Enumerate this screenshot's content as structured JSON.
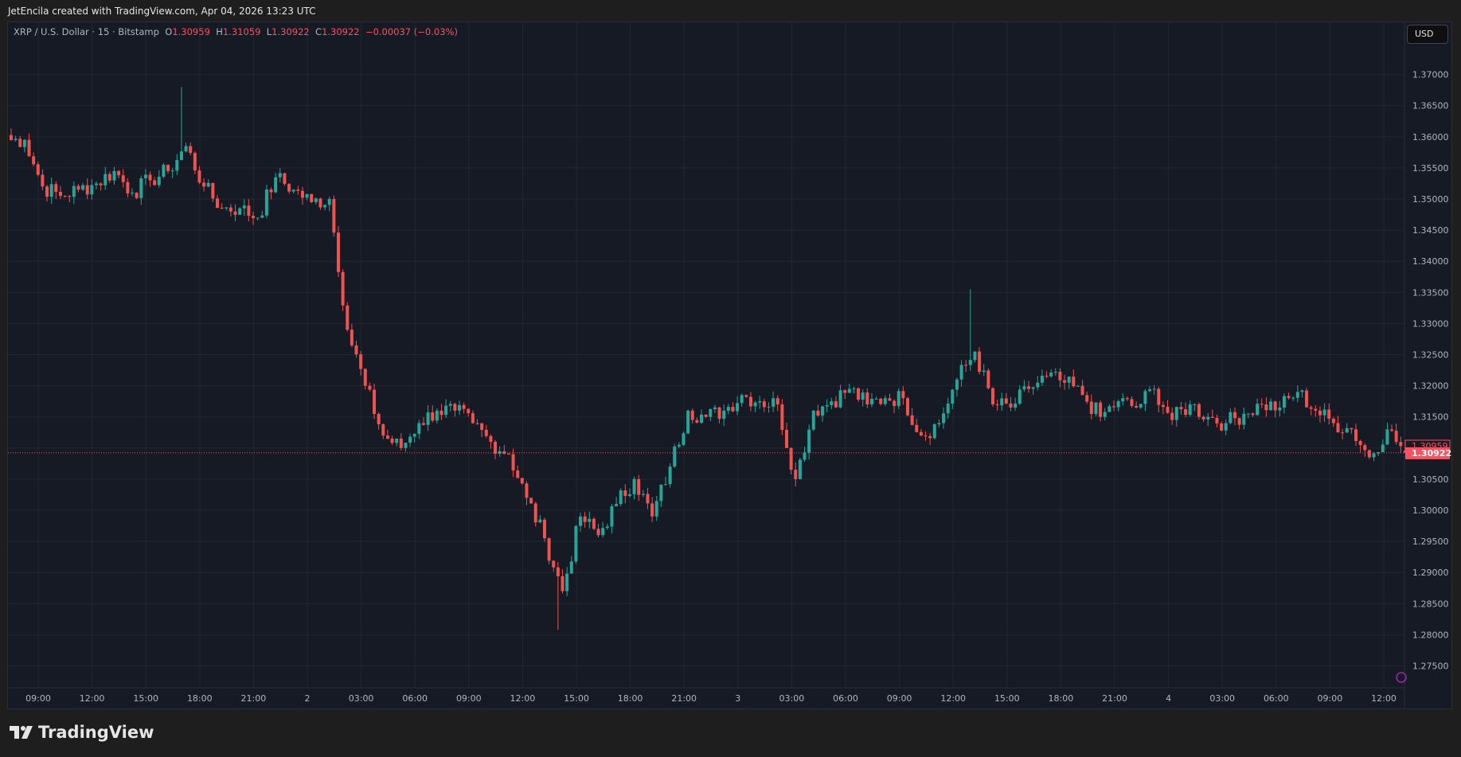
{
  "header": {
    "attribution": "JetEncila created with TradingView.com, Apr 04, 2026 13:23 UTC"
  },
  "legend": {
    "symbol": "XRP / U.S. Dollar · 15 · Bitstamp",
    "o_label": "O",
    "o": "1.30959",
    "h_label": "H",
    "h": "1.31059",
    "l_label": "L",
    "l": "1.30922",
    "c_label": "C",
    "c": "1.30922",
    "change": "−0.00037 (−0.03%)"
  },
  "currency_button": "USD",
  "logo_text": "TradingView",
  "colors": {
    "up": "#26a69a",
    "down": "#ef5350",
    "background": "#161a25",
    "grid": "#232733",
    "price_line": "#f7525f"
  },
  "chart_data": {
    "type": "candlestick",
    "interval": "15",
    "title": "XRP / U.S. Dollar · 15 · Bitstamp",
    "ylim": [
      1.2725,
      1.3745
    ],
    "y_ticks": [
      "1.37000",
      "1.36500",
      "1.36000",
      "1.35500",
      "1.35000",
      "1.34500",
      "1.34000",
      "1.33500",
      "1.33000",
      "1.32500",
      "1.32000",
      "1.31500",
      "1.31000",
      "1.30500",
      "1.30000",
      "1.29500",
      "1.29000",
      "1.28500",
      "1.28000",
      "1.27500"
    ],
    "x_ticks": [
      "09:00",
      "12:00",
      "15:00",
      "18:00",
      "21:00",
      "2",
      "03:00",
      "06:00",
      "09:00",
      "12:00",
      "15:00",
      "18:00",
      "21:00",
      "3",
      "03:00",
      "06:00",
      "09:00",
      "12:00",
      "15:00",
      "18:00",
      "21:00",
      "4",
      "03:00",
      "06:00",
      "09:00",
      "12:00"
    ],
    "first_candle_time": "07:30",
    "candle_count": 312,
    "hourly_closes": [
      1.3595,
      1.352,
      1.3505,
      1.3515,
      1.3525,
      1.3545,
      1.351,
      1.353,
      1.3545,
      1.3585,
      1.352,
      1.3485,
      1.3485,
      1.347,
      1.3535,
      1.3515,
      1.3495,
      1.35,
      1.329,
      1.32,
      1.312,
      1.31,
      1.314,
      1.316,
      1.316,
      1.314,
      1.311,
      1.309,
      1.302,
      1.2955,
      1.287,
      1.299,
      1.296,
      1.301,
      1.305,
      1.299,
      1.307,
      1.316,
      1.315,
      1.316,
      1.3185,
      1.3175,
      1.317,
      1.305,
      1.316,
      1.3175,
      1.3195,
      1.317,
      1.318,
      1.318,
      1.312,
      1.314,
      1.321,
      1.3255,
      1.317,
      1.3165,
      1.3195,
      1.3215,
      1.3205,
      1.3185,
      1.315,
      1.3175,
      1.3165,
      1.3195,
      1.3145,
      1.317,
      1.315,
      1.314,
      1.3155,
      1.317,
      1.3165,
      1.319,
      1.316,
      1.314,
      1.313,
      1.3085,
      1.313,
      1.3092
    ],
    "notable_wicks": [
      {
        "hour_index": 9,
        "high": 1.368
      },
      {
        "hour_index": 53,
        "high": 1.3355
      },
      {
        "hour_index": 30,
        "low": 1.2808
      }
    ],
    "last_candle": {
      "open": 1.30959,
      "high": 1.31059,
      "low": 1.30922,
      "close": 1.30922
    },
    "price_labels": {
      "open_marker": "1.30959",
      "last_price": "1.30922"
    }
  }
}
